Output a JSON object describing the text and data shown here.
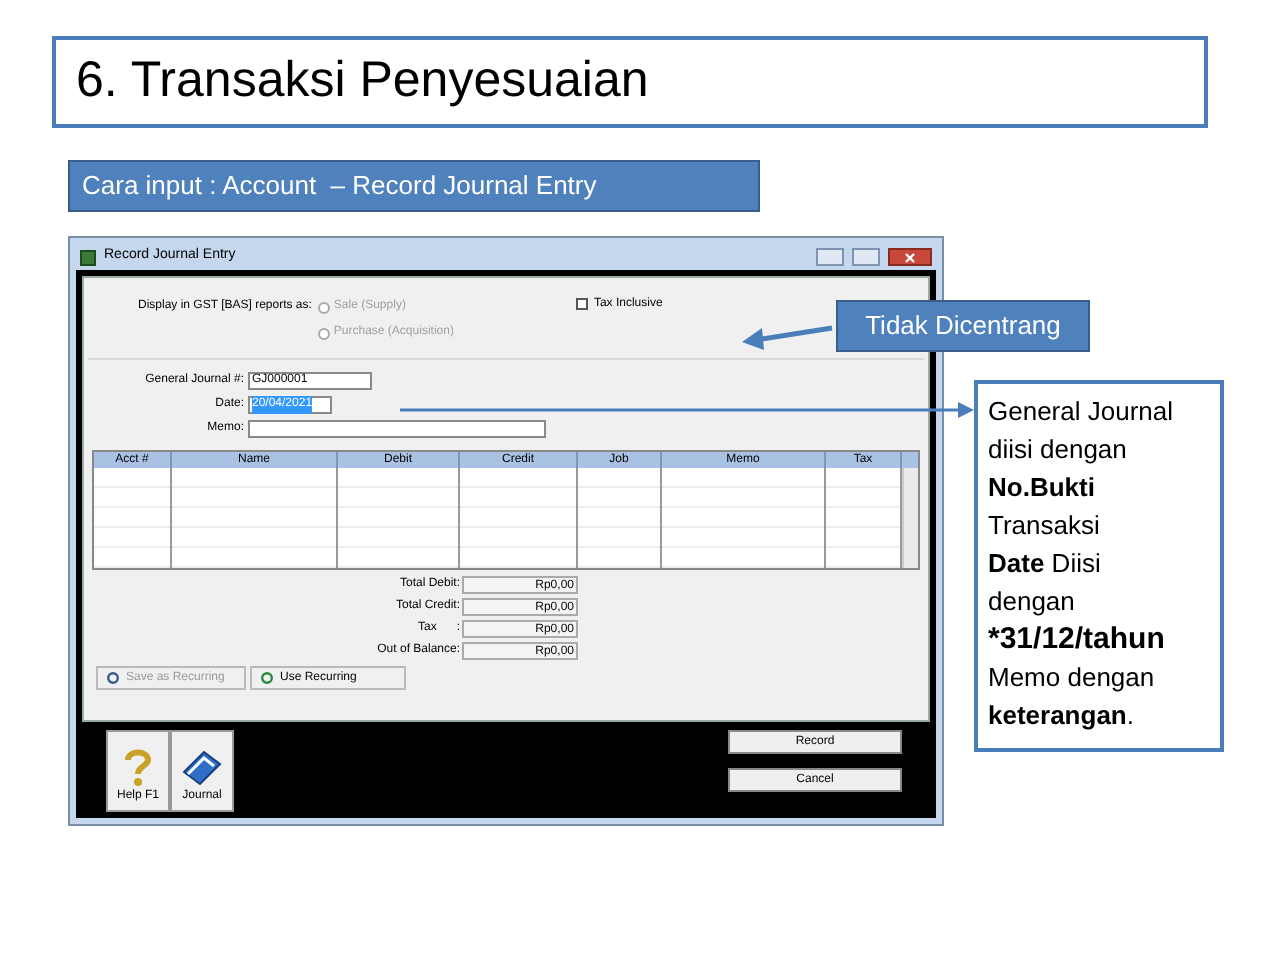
{
  "title": "6. Transaksi Penyesuaian",
  "subtitle": "Cara input : Account  – Record Journal Entry",
  "window": {
    "title": "Record Journal Entry",
    "gst_label": "Display in GST [BAS] reports as:",
    "gst_options": [
      {
        "label": "Sale (Supply)",
        "selected": false,
        "disabled": true
      },
      {
        "label": "Purchase (Acquisition)",
        "selected": false,
        "disabled": true
      }
    ],
    "tax_inclusive": {
      "label": "Tax Inclusive",
      "checked": false
    },
    "fields": [
      {
        "label": "General Journal #:",
        "value": "GJ000001"
      },
      {
        "label": "Date:",
        "value": "20/04/2021",
        "highlighted": true
      },
      {
        "label": "Memo:"
      }
    ],
    "table": {
      "columns": [
        "Acct #",
        "Name",
        "Debit",
        "Credit",
        "Job",
        "Memo",
        "Tax"
      ]
    },
    "totals": [
      {
        "label": "Total Debit:",
        "value": "Rp0,00"
      },
      {
        "label": "Total Credit:",
        "value": "Rp0,00"
      },
      {
        "label": "Tax      :",
        "value": "Rp0,00"
      },
      {
        "label": "Out of Balance:",
        "value": "Rp0,00"
      }
    ],
    "recurring_buttons": [
      {
        "label": "Save as Recurring",
        "disabled": true
      },
      {
        "label": "Use Recurring",
        "disabled": false
      }
    ],
    "tool_buttons": [
      "Help F1",
      "Journal"
    ],
    "action_buttons": [
      "Record",
      "Cancel"
    ]
  },
  "callout": "Tidak Dicentrang",
  "note_lines": [
    "General Journal",
    "diisi dengan",
    "**No.Bukti**",
    "Transaksi",
    "**Date** Diisi",
    "dengan",
    "***31/12/tahun**",
    "Memo dengan",
    "**keterangan**."
  ]
}
